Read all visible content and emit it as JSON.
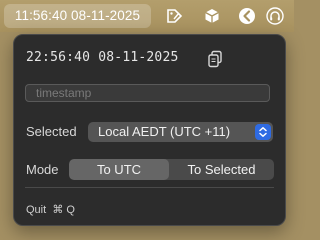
{
  "menubar": {
    "clock": "11:56:40 08-11-2025",
    "icons": [
      "airport-tag-icon",
      "cube-icon",
      "back-circle-icon",
      "headphones-icon"
    ]
  },
  "panel": {
    "timestamp": "22:56:40 08-11-2025",
    "copy_icon": "copy-icon",
    "input_placeholder": "timestamp",
    "input_value": "",
    "selected_label": "Selected",
    "selected_value": "Local AEDT (UTC +11)",
    "mode_label": "Mode",
    "mode_options": [
      "To UTC",
      "To Selected"
    ],
    "mode_selected": "To UTC",
    "quit_label": "Quit",
    "quit_shortcut": "⌘ Q"
  },
  "colors": {
    "menubar": "#a8925f",
    "panel_bg": "#2c2c2c",
    "segment_selected": "#666666",
    "stepper_accent": "#2f6be3"
  }
}
